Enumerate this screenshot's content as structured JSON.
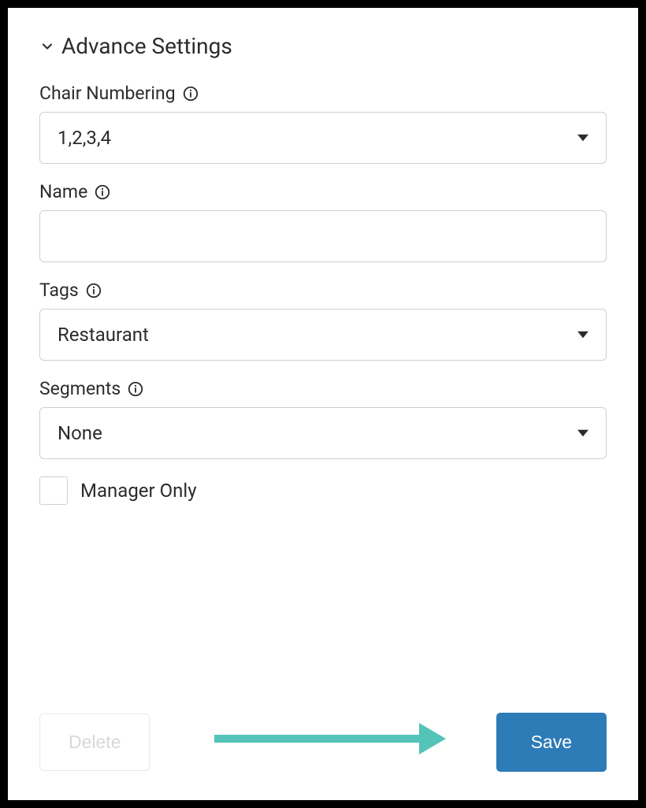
{
  "section": {
    "title": "Advance Settings"
  },
  "fields": {
    "chair_numbering": {
      "label": "Chair Numbering",
      "value": "1,2,3,4"
    },
    "name": {
      "label": "Name",
      "value": ""
    },
    "tags": {
      "label": "Tags",
      "value": "Restaurant"
    },
    "segments": {
      "label": "Segments",
      "value": "None"
    },
    "manager_only": {
      "label": "Manager Only",
      "checked": false
    }
  },
  "buttons": {
    "delete": "Delete",
    "save": "Save"
  },
  "colors": {
    "primary": "#2d7cb8",
    "annotation": "#54c4b8",
    "border": "#cfcfcf",
    "text": "#2c2c2c"
  }
}
